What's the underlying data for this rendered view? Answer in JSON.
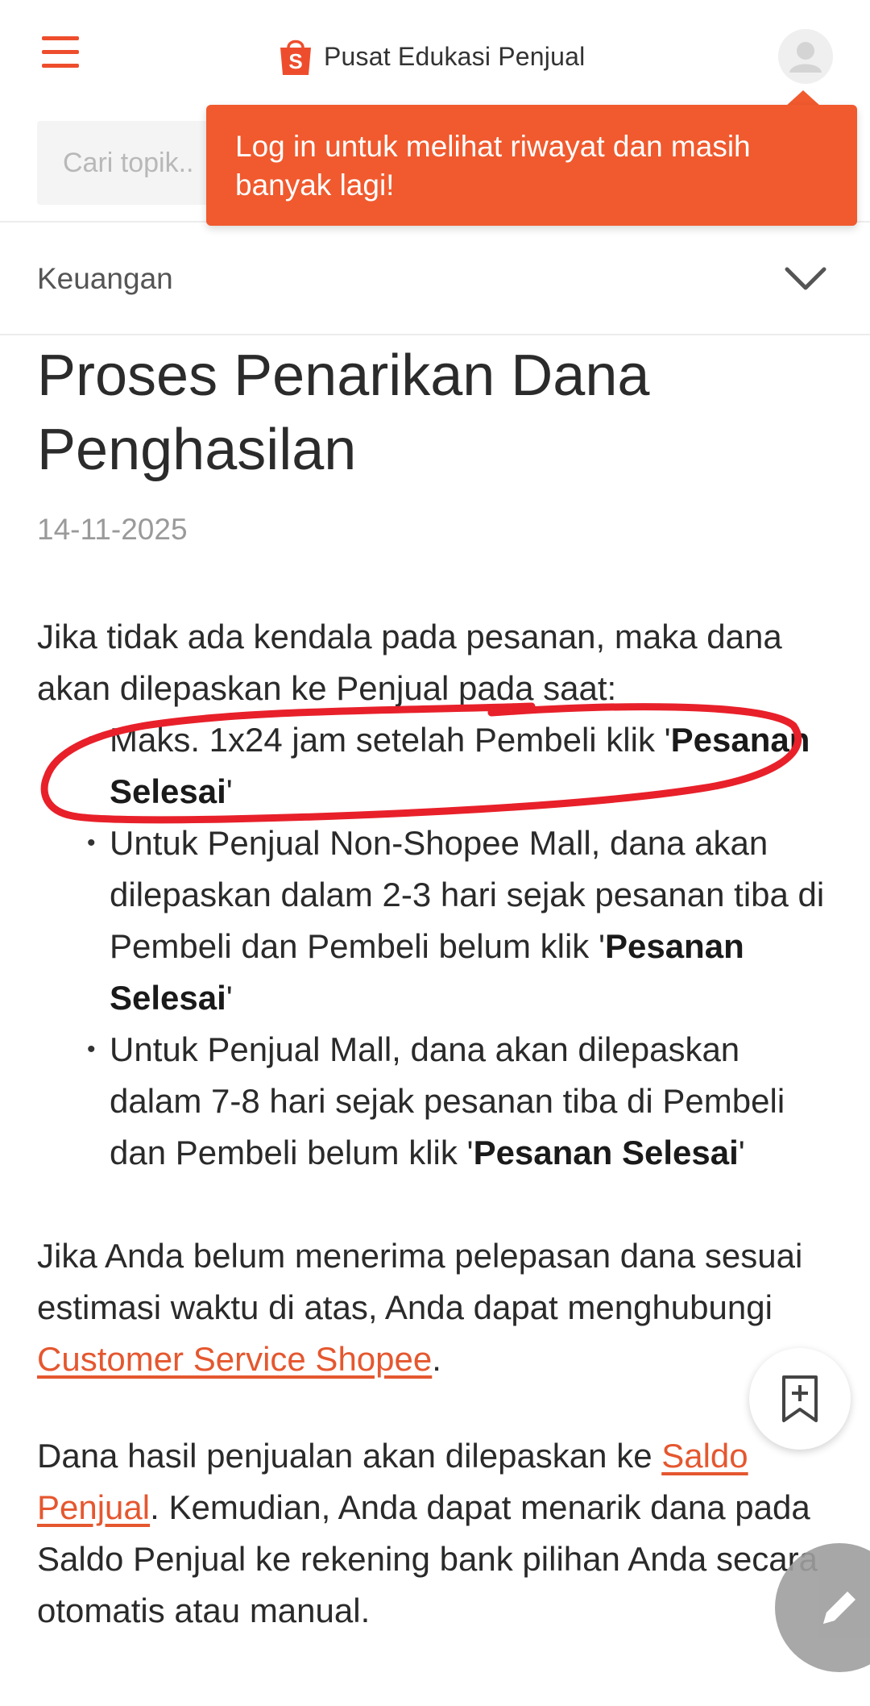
{
  "header": {
    "brand_title": "Pusat Edukasi Penjual",
    "search_placeholder": "Cari topik..",
    "tooltip_text": "Log in untuk melihat riwayat dan masih banyak lagi!"
  },
  "category": {
    "label": "Keuangan"
  },
  "article": {
    "title": "Proses Penarikan Dana Penghasilan",
    "date": "14-11-2025",
    "intro": "Jika tidak ada kendala pada pesanan, maka dana akan dilepaskan ke Penjual pada saat:",
    "points": [
      {
        "text": "Maks. 1x24 jam setelah Pembeli klik '",
        "bold": "Pesanan Selesai",
        "end": "'"
      },
      {
        "text": "Untuk Penjual Non-Shopee Mall, dana akan dilepaskan dalam 2-3 hari sejak pesanan tiba di Pembeli dan Pembeli belum klik '",
        "bold": "Pesanan Selesai",
        "end": "'"
      },
      {
        "text": "Untuk Penjual Mall, dana akan dilepaskan dalam 7-8 hari sejak pesanan tiba di Pembeli dan Pembeli belum klik '",
        "bold": "Pesanan Selesai",
        "end": "'"
      }
    ],
    "p2_before": "Jika Anda belum menerima pelepasan dana sesuai estimasi waktu di atas, Anda dapat menghubungi ",
    "p2_link": "Customer Service Shopee",
    "p2_after": ".",
    "p3_before": "Dana hasil penjualan akan dilepaskan ke ",
    "p3_link": "Saldo Penjual",
    "p3_after": ". Kemudian, Anda dapat menarik dana pada Saldo Penjual ke rekening bank pilihan Anda secara otomatis atau manual."
  },
  "colors": {
    "brand": "#ee4d2d",
    "tooltip_bg": "#f05a2e",
    "annotation": "#e8202a"
  },
  "icons": [
    "menu-icon",
    "shopee-bag-icon",
    "user-avatar-icon",
    "chevron-down-icon",
    "bookmark-add-icon",
    "pencil-icon"
  ]
}
